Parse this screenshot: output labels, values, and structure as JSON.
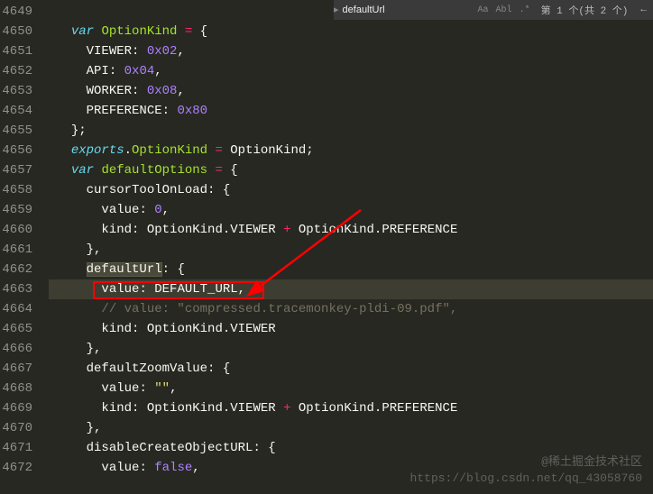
{
  "search": {
    "value": "defaultUrl",
    "opt_case": "Aa",
    "opt_word": "Abl",
    "opt_regex": ".*",
    "count": "第 1 个(共 2 个)",
    "prev": "←",
    "next": "→",
    "menu": "≡",
    "close": "✕"
  },
  "gutter": [
    "4649",
    "4650",
    "4651",
    "4652",
    "4653",
    "4654",
    "4655",
    "4656",
    "4657",
    "4658",
    "4659",
    "4660",
    "4661",
    "4662",
    "4663",
    "4664",
    "4665",
    "4666",
    "4667",
    "4668",
    "4669",
    "4670",
    "4671",
    "4672"
  ],
  "code": {
    "l4650": {
      "var": "var",
      "name": "OptionKind",
      "eq": "=",
      "brace": "{"
    },
    "l4651": {
      "prop": "VIEWER",
      "colon": ":",
      "val": "0x02",
      "comma": ","
    },
    "l4652": {
      "prop": "API",
      "colon": ":",
      "val": "0x04",
      "comma": ","
    },
    "l4653": {
      "prop": "WORKER",
      "colon": ":",
      "val": "0x08",
      "comma": ","
    },
    "l4654": {
      "prop": "PREFERENCE",
      "colon": ":",
      "val": "0x80"
    },
    "l4655": {
      "close": "};"
    },
    "l4656": {
      "exports": "exports",
      "dot": ".",
      "prop": "OptionKind",
      "eq": "=",
      "val": "OptionKind",
      "semi": ";"
    },
    "l4657": {
      "var": "var",
      "name": "defaultOptions",
      "eq": "=",
      "brace": "{"
    },
    "l4658": {
      "prop": "cursorToolOnLoad",
      "colon": ":",
      "brace": "{"
    },
    "l4659": {
      "prop": "value",
      "colon": ":",
      "val": "0",
      "comma": ","
    },
    "l4660": {
      "prop": "kind",
      "colon": ":",
      "o1": "OptionKind",
      "d1": ".",
      "p1": "VIEWER",
      "plus": "+",
      "o2": "OptionKind",
      "d2": ".",
      "p2": "PREFERENCE"
    },
    "l4661": {
      "close": "},"
    },
    "l4662": {
      "prop": "defaultUrl",
      "colon": ":",
      "brace": "{"
    },
    "l4663": {
      "prop": "value",
      "colon": ":",
      "val": "DEFAULT_URL",
      "comma": ","
    },
    "l4664": {
      "comment": "// value: \"compressed.tracemonkey-pldi-09.pdf\","
    },
    "l4665": {
      "prop": "kind",
      "colon": ":",
      "o1": "OptionKind",
      "d1": ".",
      "p1": "VIEWER"
    },
    "l4666": {
      "close": "},"
    },
    "l4667": {
      "prop": "defaultZoomValue",
      "colon": ":",
      "brace": "{"
    },
    "l4668": {
      "prop": "value",
      "colon": ":",
      "val": "\"\"",
      "comma": ","
    },
    "l4669": {
      "prop": "kind",
      "colon": ":",
      "o1": "OptionKind",
      "d1": ".",
      "p1": "VIEWER",
      "plus": "+",
      "o2": "OptionKind",
      "d2": ".",
      "p2": "PREFERENCE"
    },
    "l4670": {
      "close": "},"
    },
    "l4671": {
      "prop": "disableCreateObjectURL",
      "colon": ":",
      "brace": "{"
    },
    "l4672": {
      "prop": "value",
      "colon": ":",
      "val": "false",
      "comma": ","
    }
  },
  "watermark1": "@稀土掘金技术社区",
  "watermark2": "https://blog.csdn.net/qq_43058760"
}
